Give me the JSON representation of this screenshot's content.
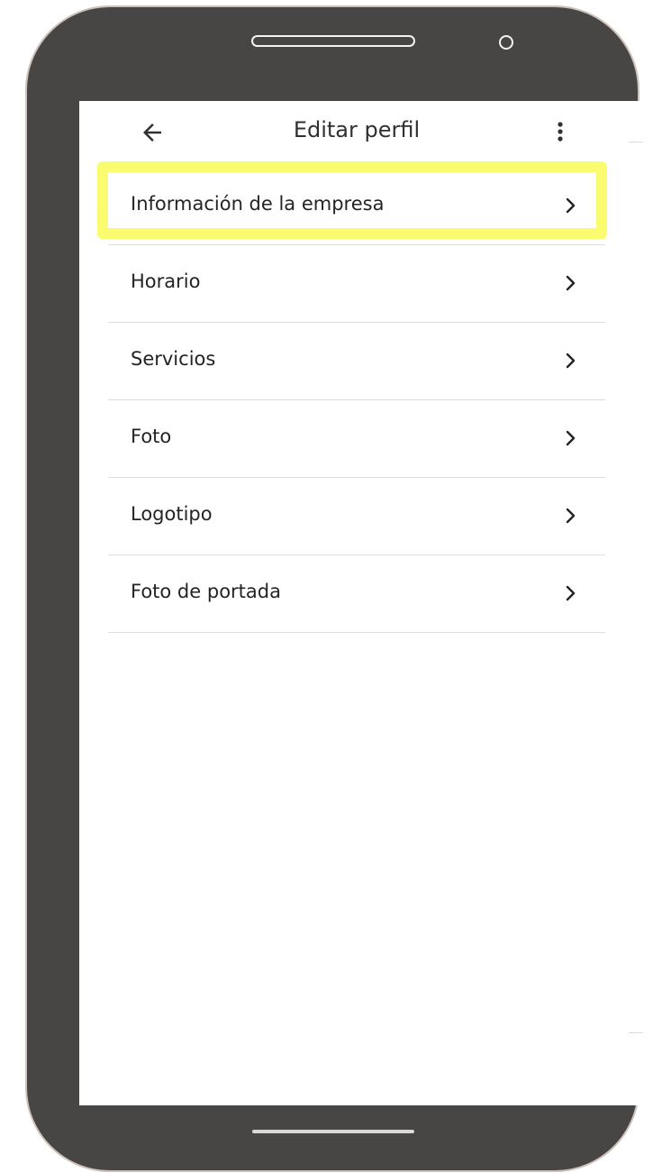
{
  "appbar": {
    "title": "Editar perfil",
    "back_icon": "arrow-left-icon",
    "more_icon": "more-vert-icon"
  },
  "menu": {
    "items": [
      {
        "label": "Información de la empresa",
        "icon": "chevron-right-icon",
        "highlighted": true
      },
      {
        "label": "Horario",
        "icon": "chevron-right-icon"
      },
      {
        "label": "Servicios",
        "icon": "chevron-right-icon"
      },
      {
        "label": "Foto",
        "icon": "chevron-right-icon"
      },
      {
        "label": "Logotipo",
        "icon": "chevron-right-icon"
      },
      {
        "label": "Foto de portada",
        "icon": "chevron-right-icon"
      }
    ]
  },
  "colors": {
    "phone_body": "#474645",
    "highlight": "#fbfb70",
    "text": "#242424",
    "divider": "#dedede"
  }
}
